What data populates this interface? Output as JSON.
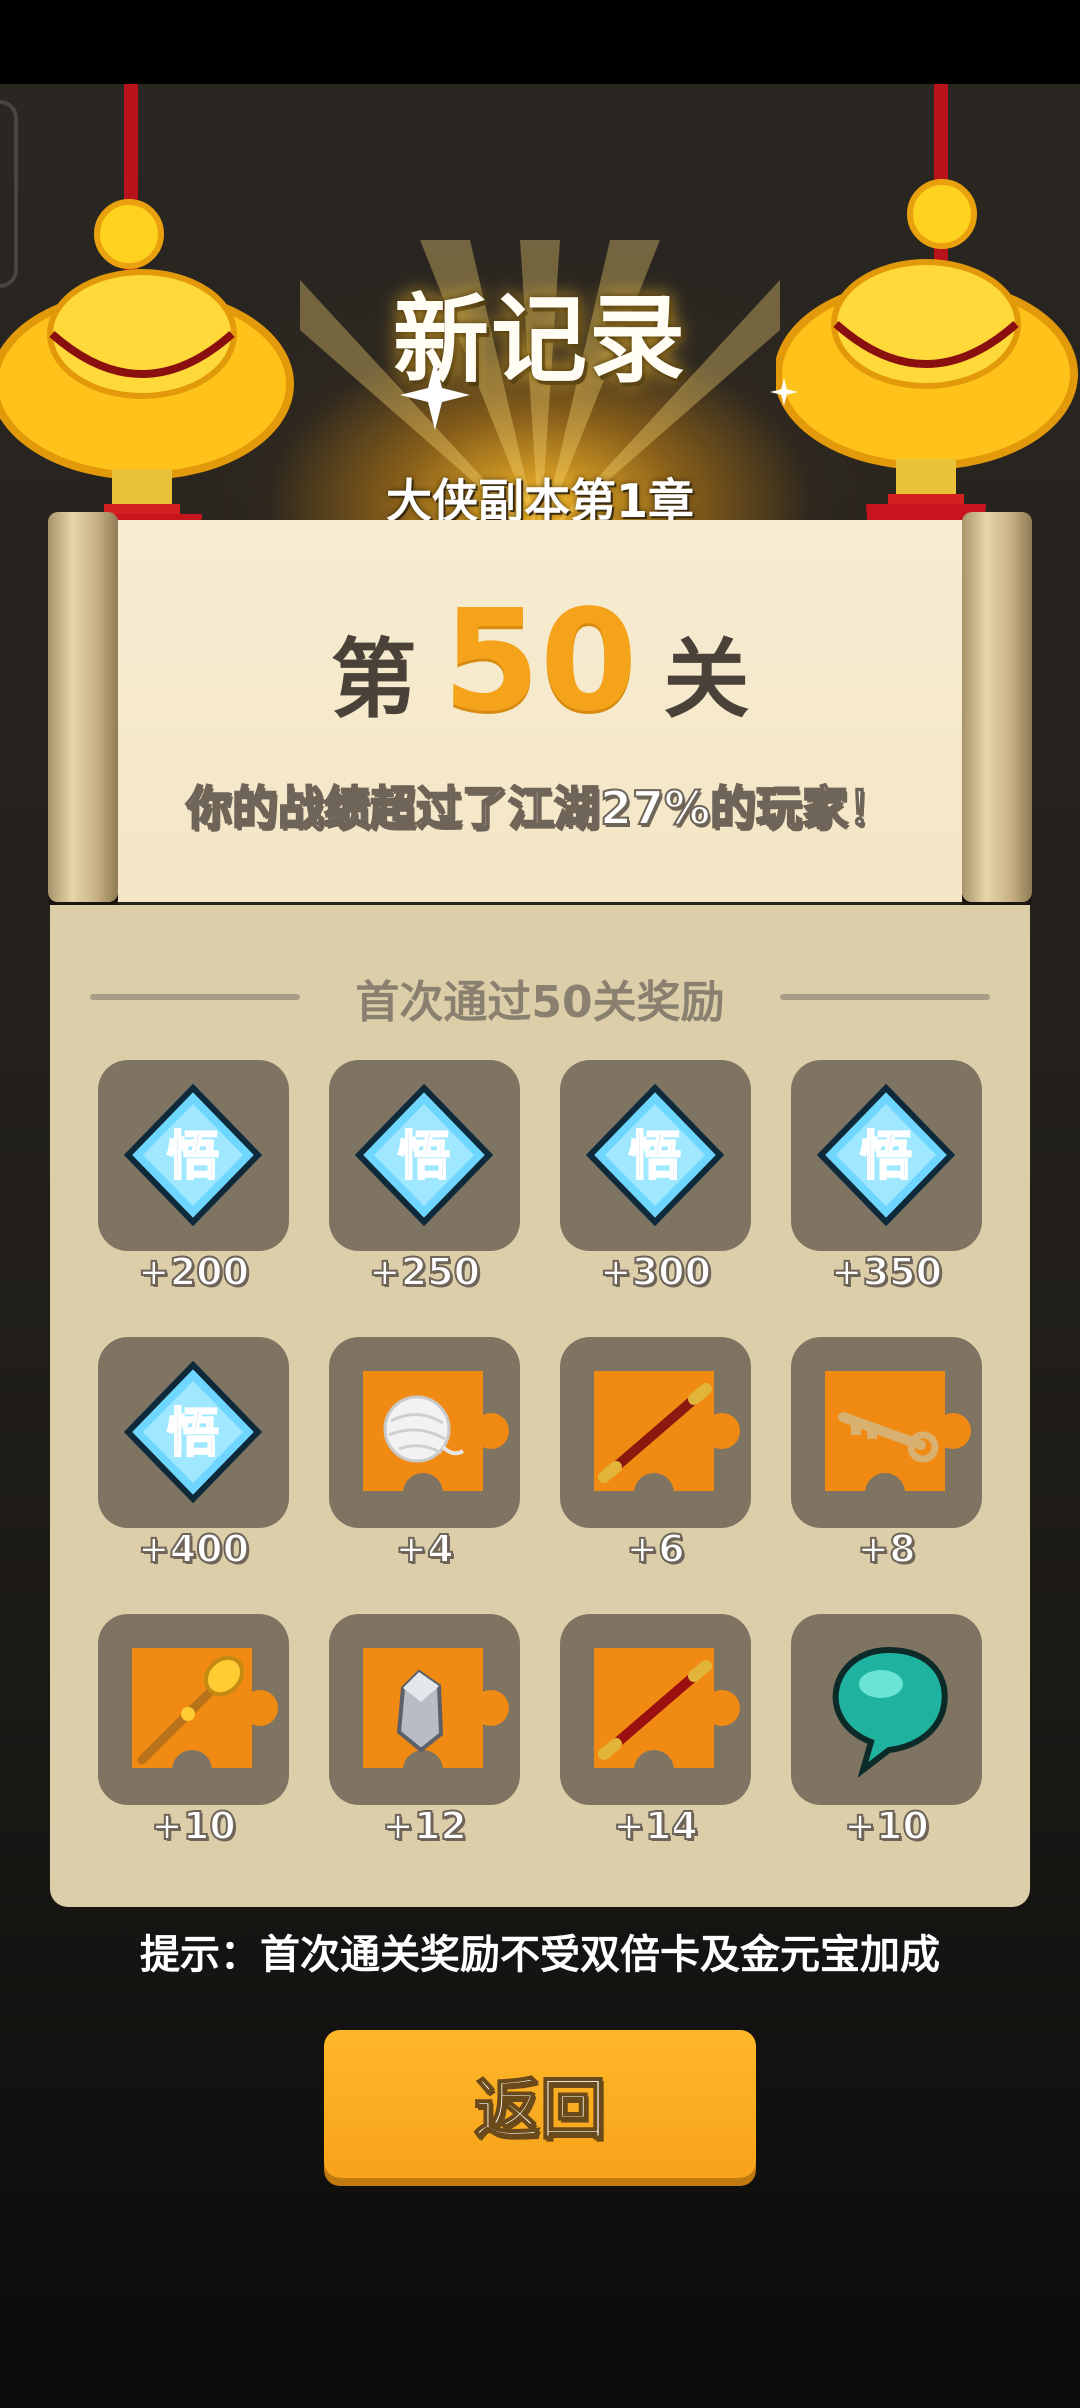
{
  "header": {
    "title": "新记录",
    "subtitle": "大侠副本第1章"
  },
  "level": {
    "prefix": "第",
    "number": "50",
    "suffix": "关",
    "percentile_text": "你的战绩超过了江湖27%的玩家！"
  },
  "rewards": {
    "title": "首次通过50关奖励",
    "items": [
      {
        "icon": "wu-gem-icon",
        "count": "+200"
      },
      {
        "icon": "wu-gem-icon",
        "count": "+250"
      },
      {
        "icon": "wu-gem-icon",
        "count": "+300"
      },
      {
        "icon": "wu-gem-icon",
        "count": "+350"
      },
      {
        "icon": "wu-gem-icon",
        "count": "+400"
      },
      {
        "icon": "yarn-ball-puzzle-icon",
        "count": "+4"
      },
      {
        "icon": "staff-puzzle-icon",
        "count": "+6"
      },
      {
        "icon": "key-puzzle-icon",
        "count": "+8"
      },
      {
        "icon": "golden-scepter-puzzle-icon",
        "count": "+10"
      },
      {
        "icon": "silver-ingot-puzzle-icon",
        "count": "+12"
      },
      {
        "icon": "red-staff-puzzle-icon",
        "count": "+14"
      },
      {
        "icon": "teal-gem-icon",
        "count": "+10"
      }
    ]
  },
  "tip": "提示：首次通关奖励不受双倍卡及金元宝加成",
  "buttons": {
    "back_label": "返回"
  },
  "colors": {
    "accent": "#f7a31b",
    "level_number": "#f5a31a",
    "panel": "#ddceaa",
    "scroll": "#f4e6c6",
    "tile": "#7f7462"
  }
}
